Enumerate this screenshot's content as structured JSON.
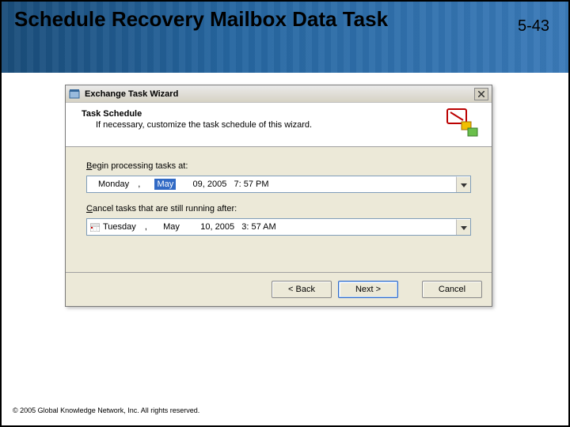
{
  "slide": {
    "title": "Schedule Recovery Mailbox Data Task",
    "number": "5-43"
  },
  "wizard": {
    "window_title": "Exchange Task Wizard",
    "heading": "Task Schedule",
    "subheading": "If necessary, customize the task schedule of this wizard.",
    "begin": {
      "label_pre": "B",
      "label_post": "egin processing tasks at:",
      "day": "Monday",
      "sep": " ,    ",
      "month": "May",
      "rest": "     09, 2005   7: 57 PM"
    },
    "cancel": {
      "label_pre": "C",
      "label_post": "ancel tasks that are still running after:",
      "day": "Tuesday",
      "sep1": " ,    ",
      "month": "May",
      "rest": "      10, 2005   3: 57 AM"
    },
    "buttons": {
      "back": "< Back",
      "next": "Next >",
      "cancel": "Cancel"
    }
  },
  "copyright": "© 2005 Global Knowledge Network, Inc. All rights reserved."
}
